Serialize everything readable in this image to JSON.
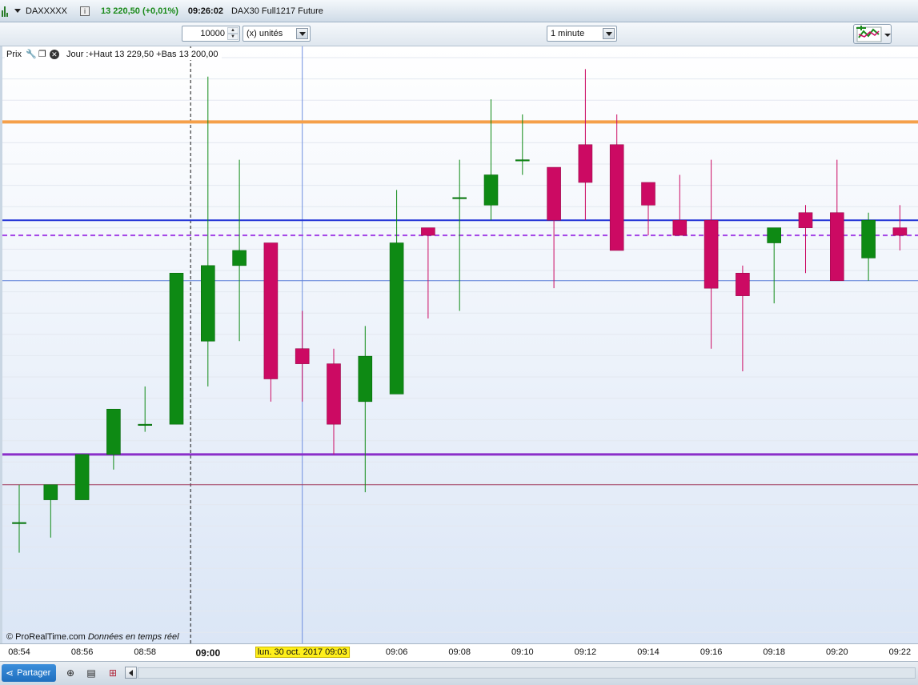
{
  "header": {
    "symbol": "DAXXXXX",
    "info_icon_label": "i",
    "price_change": "13 220,50 (+0,01%)",
    "time": "09:26:02",
    "instrument": "DAX30 Full1217 Future"
  },
  "toolbar": {
    "quantity": "10000",
    "units": "(x) unités",
    "interval": "1 minute"
  },
  "legend": {
    "price_label": "Prix",
    "day_info": "Jour :+Haut 13 229,50 +Bas 13 200,00"
  },
  "credit": {
    "site": "© ProRealTime.com",
    "note": "Données en temps réel"
  },
  "footer": {
    "share_label": "Partager"
  },
  "colors": {
    "bull": "#0e8a14",
    "bear": "#cc0a63",
    "orange_line": "#f5a04a",
    "blue_line": "#2233d6",
    "purple_line": "#8a2fc9",
    "dashed_purple": "#a445e6"
  },
  "chart_data": {
    "type": "candlestick",
    "title": "",
    "xlabel": "",
    "ylabel": "",
    "x_ticks": [
      {
        "label": "08:54",
        "i": 0
      },
      {
        "label": "08:56",
        "i": 2
      },
      {
        "label": "08:58",
        "i": 4
      },
      {
        "label": "09:00",
        "i": 6,
        "bold": true
      },
      {
        "label": "09:06",
        "i": 12
      },
      {
        "label": "09:08",
        "i": 14
      },
      {
        "label": "09:10",
        "i": 16
      },
      {
        "label": "09:12",
        "i": 18
      },
      {
        "label": "09:14",
        "i": 20
      },
      {
        "label": "09:16",
        "i": 22
      },
      {
        "label": "09:18",
        "i": 24
      },
      {
        "label": "09:20",
        "i": 26
      },
      {
        "label": "09:22",
        "i": 28
      }
    ],
    "cursor_label": "lun. 30 oct. 2017 09:03",
    "cursor_index": 9,
    "session_index": 5.5,
    "ylim": [
      13195.0,
      13234.5
    ],
    "candles": [
      {
        "o": 13203.0,
        "h": 13205.5,
        "l": 13201.0,
        "c": 13203.0
      },
      {
        "o": 13204.5,
        "h": 13205.5,
        "l": 13202.0,
        "c": 13205.5
      },
      {
        "o": 13204.5,
        "h": 13206.5,
        "l": 13204.5,
        "c": 13207.5
      },
      {
        "o": 13207.5,
        "h": 13210.5,
        "l": 13206.5,
        "c": 13210.5
      },
      {
        "o": 13209.5,
        "h": 13212.0,
        "l": 13209.0,
        "c": 13209.5
      },
      {
        "o": 13209.5,
        "h": 13219.5,
        "l": 13209.5,
        "c": 13219.5
      },
      {
        "o": 13215.0,
        "h": 13232.5,
        "l": 13212.0,
        "c": 13220.0
      },
      {
        "o": 13220.0,
        "h": 13227.0,
        "l": 13215.0,
        "c": 13221.0
      },
      {
        "o": 13221.5,
        "h": 13221.5,
        "l": 13211.0,
        "c": 13212.5
      },
      {
        "o": 13214.5,
        "h": 13217.0,
        "l": 13211.0,
        "c": 13213.5
      },
      {
        "o": 13213.5,
        "h": 13214.5,
        "l": 13207.5,
        "c": 13209.5
      },
      {
        "o": 13211.0,
        "h": 13216.0,
        "l": 13205.0,
        "c": 13214.0
      },
      {
        "o": 13211.5,
        "h": 13225.0,
        "l": 13212.0,
        "c": 13221.5
      },
      {
        "o": 13222.5,
        "h": 13222.5,
        "l": 13216.5,
        "c": 13222.0
      },
      {
        "o": 13224.5,
        "h": 13227.0,
        "l": 13217.0,
        "c": 13224.5
      },
      {
        "o": 13224.0,
        "h": 13231.0,
        "l": 13223.0,
        "c": 13226.0
      },
      {
        "o": 13227.0,
        "h": 13230.0,
        "l": 13226.0,
        "c": 13227.0
      },
      {
        "o": 13226.5,
        "h": 13226.5,
        "l": 13218.5,
        "c": 13223.0
      },
      {
        "o": 13228.0,
        "h": 13233.0,
        "l": 13223.0,
        "c": 13225.5
      },
      {
        "o": 13228.0,
        "h": 13230.0,
        "l": 13221.5,
        "c": 13221.0
      },
      {
        "o": 13225.5,
        "h": 13225.5,
        "l": 13222.0,
        "c": 13224.0
      },
      {
        "o": 13223.0,
        "h": 13226.0,
        "l": 13222.0,
        "c": 13222.0
      },
      {
        "o": 13223.0,
        "h": 13227.0,
        "l": 13214.5,
        "c": 13218.5
      },
      {
        "o": 13219.5,
        "h": 13220.0,
        "l": 13213.0,
        "c": 13218.0
      },
      {
        "o": 13221.5,
        "h": 13222.0,
        "l": 13217.5,
        "c": 13222.5
      },
      {
        "o": 13223.5,
        "h": 13224.0,
        "l": 13219.5,
        "c": 13222.5
      },
      {
        "o": 13223.5,
        "h": 13227.0,
        "l": 13219.0,
        "c": 13219.0
      },
      {
        "o": 13220.5,
        "h": 13223.5,
        "l": 13219.0,
        "c": 13223.0
      },
      {
        "o": 13222.5,
        "h": 13224.0,
        "l": 13221.0,
        "c": 13222.0
      }
    ],
    "hlines": [
      {
        "name": "orange",
        "y": 13229.5,
        "color": "#f5a04a",
        "width": 4
      },
      {
        "name": "blue",
        "y": 13223.0,
        "color": "#2233d6",
        "width": 2
      },
      {
        "name": "dashed-purple",
        "y": 13222.0,
        "color": "#a445e6",
        "width": 2,
        "dash": true
      },
      {
        "name": "thin-blue",
        "y": 13219.0,
        "color": "#5b7fd8",
        "width": 1
      },
      {
        "name": "purple",
        "y": 13207.5,
        "color": "#8a2fc9",
        "width": 3
      },
      {
        "name": "thin-maroon",
        "y": 13205.5,
        "color": "#a0395c",
        "width": 1
      }
    ]
  }
}
